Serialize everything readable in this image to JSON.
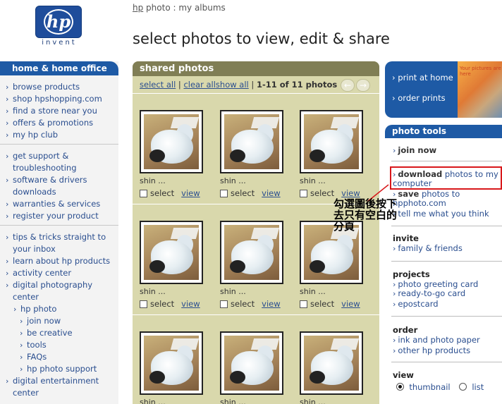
{
  "logo": {
    "mark": "hp",
    "tagline": "invent"
  },
  "breadcrumb": {
    "hp": "hp",
    "rest": " photo : my albums"
  },
  "title": "select photos to view, edit & share",
  "left_nav": {
    "header": "home & home office",
    "groups": [
      [
        "browse products",
        "shop hpshopping.com",
        "find a store near you",
        "offers & promotions",
        "my hp club"
      ],
      [
        "get support & troubleshooting",
        "software & drivers downloads",
        "warranties & services",
        "register your product"
      ]
    ],
    "group3": {
      "tips": "tips & tricks straight to your inbox",
      "learn": "learn about hp products",
      "activity": "activity center",
      "digital": "digital photography center",
      "hp_photo": "hp photo",
      "sub": [
        "join now",
        "be creative",
        "tools",
        "FAQs",
        "hp photo support"
      ],
      "entertainment": "digital entertainment center"
    }
  },
  "panel": {
    "header": "shared photos",
    "select_all": "select all",
    "clear_all": "clear all",
    "show_all": "show all",
    "separator": "|",
    "count": "1-11 of 11 photos",
    "prev": "←",
    "next": "→",
    "caption": "shin ...",
    "select_label": "select",
    "view_label": "view"
  },
  "promo": {
    "print_at_home": "print at home",
    "order_prints": "order prints",
    "image_text": "Your pictures are here"
  },
  "tools": {
    "header": "photo tools",
    "join_now": "join now",
    "download_bold": "download",
    "download_rest": " photos to my computer",
    "save_bold": "save",
    "save_rest": " photos to hpphoto.com",
    "tell": "tell me what you think"
  },
  "invite": {
    "title": "invite",
    "family": "family & friends"
  },
  "projects": {
    "title": "projects",
    "items": [
      "photo greeting card",
      "ready-to-go card",
      "epostcard"
    ]
  },
  "order": {
    "title": "order",
    "items": [
      "ink and photo paper",
      "other hp products"
    ]
  },
  "view": {
    "title": "view",
    "thumbnail": "thumbnail",
    "list": "list",
    "selected": "thumbnail"
  },
  "annotation": {
    "text": "勾選圖後按下去只有空白的分頁"
  },
  "colors": {
    "accent_blue": "#1e5aa5",
    "panel_olive": "#d9d8ac",
    "panel_head": "#807e55",
    "highlight_red": "#d8181b"
  }
}
